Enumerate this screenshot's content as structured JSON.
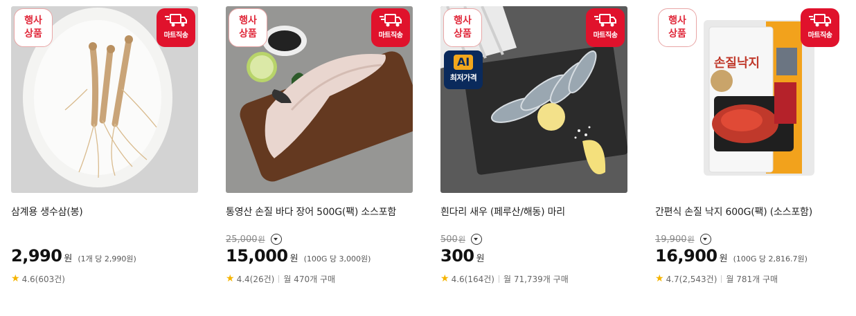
{
  "badges": {
    "event_line1": "행사",
    "event_line2": "상품",
    "mart_ship": "마트직송",
    "ai_top": "AI",
    "ai_bottom": "최저가격"
  },
  "currency": "원",
  "products": [
    {
      "name": "삼계용 생수삼(봉)",
      "original_price": "",
      "price": "2,990",
      "unit_price": "(1개 당 2,990원)",
      "rating": "4.6(603건)",
      "monthly_sold": "",
      "ai_badge": false
    },
    {
      "name": "통영산 손질 바다 장어 500G(팩) 소스포함",
      "original_price": "25,000",
      "price": "15,000",
      "unit_price": "(100G 당 3,000원)",
      "rating": "4.4(26건)",
      "monthly_sold": "월 470개 구매",
      "ai_badge": false
    },
    {
      "name": "흰다리 새우 (페루산/해동) 마리",
      "original_price": "500",
      "price": "300",
      "unit_price": "",
      "rating": "4.6(164건)",
      "monthly_sold": "월 71,739개 구매",
      "ai_badge": true
    },
    {
      "name": "간편식 손질 낙지 600G(팩) (소스포함)",
      "original_price": "19,900",
      "price": "16,900",
      "unit_price": "(100G 당 2,816.7원)",
      "rating": "4.7(2,543건)",
      "monthly_sold": "월 781개 구매",
      "ai_badge": false,
      "package_text": "손질낙지"
    }
  ]
}
